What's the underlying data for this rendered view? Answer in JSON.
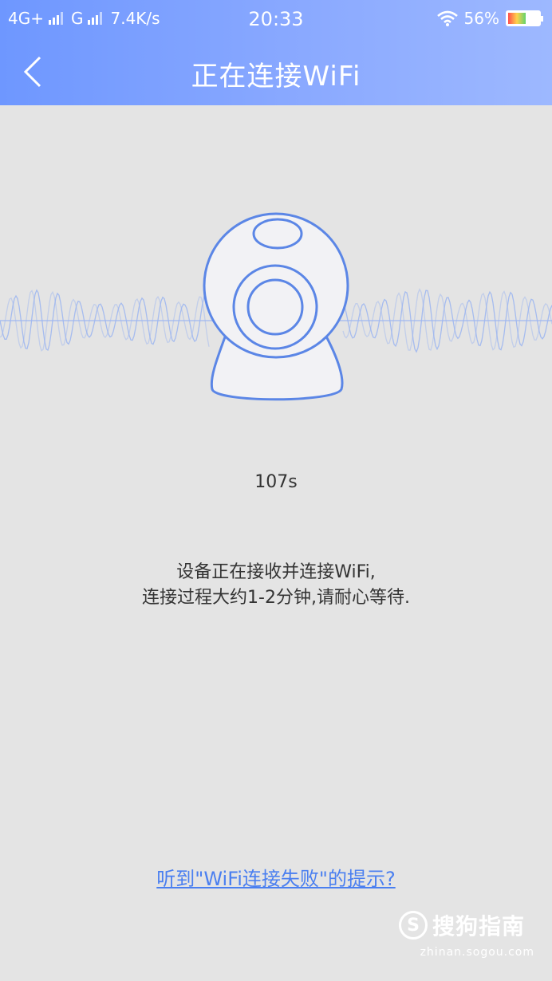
{
  "status_bar": {
    "network1": "4G+",
    "network2": "G",
    "speed": "7.4K/s",
    "time": "20:33",
    "battery_text": "56%",
    "battery_level": 0.56
  },
  "nav": {
    "title": "正在连接WiFi",
    "back_icon": "chevron-left-icon"
  },
  "main": {
    "timer": "107s",
    "desc_line1": "设备正在接收并连接WiFi,",
    "desc_line2": "连接过程大约1-2分钟,请耐心等待.",
    "hint_link": "听到\"WiFi连接失败\"的提示?"
  },
  "watermark": {
    "logo": "S",
    "name": "搜狗指南",
    "url": "zhinan.sogou.com"
  },
  "colors": {
    "accent": "#6e97ff",
    "link": "#4a7ff0",
    "camera_stroke": "#5b86e6",
    "wave": "#9fb7f0"
  }
}
